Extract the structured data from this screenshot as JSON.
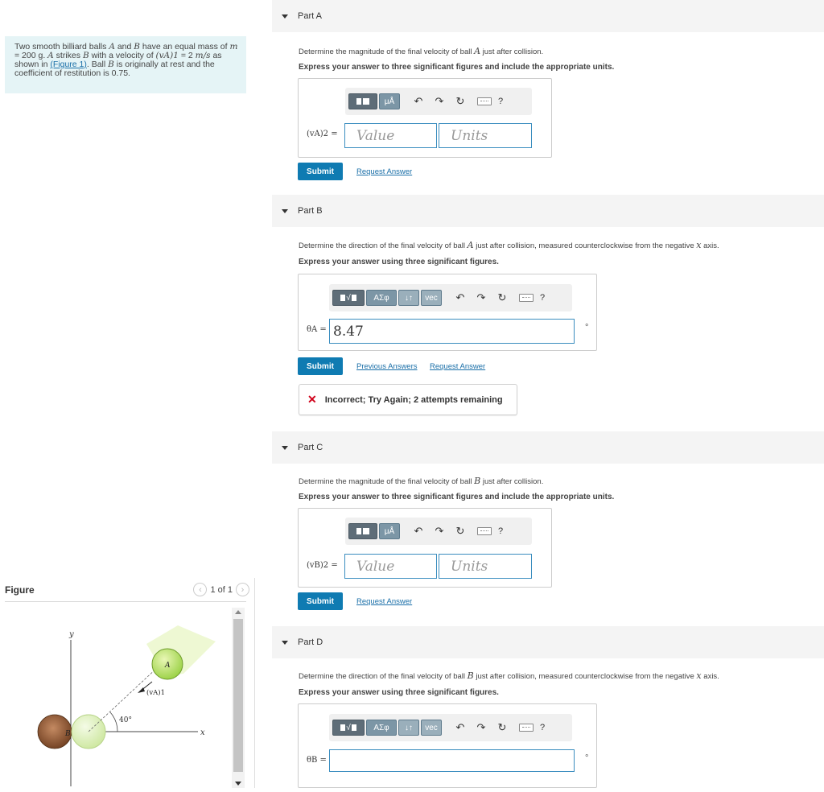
{
  "problem": {
    "text_1": "Two smooth billiard balls ",
    "var_A": "A",
    "text_2": " and ",
    "var_B": "B",
    "text_3": " have an equal mass of ",
    "mass_expr": "m",
    "text_4": " = 200 g. ",
    "var_A2": "A",
    "text_5": " strikes ",
    "var_B2": "B",
    "text_6": " with a velocity of ",
    "velocity_expr": "(vA)1",
    "text_7": " = 2 ",
    "units_expr": "m/s",
    "text_8": " as shown in ",
    "figure_link": "(Figure 1)",
    "text_9": ". Ball ",
    "var_B3": "B",
    "text_10": " is originally at rest and the coefficient of restitution is 0.75."
  },
  "figure": {
    "title": "Figure",
    "page_indicator": "1 of 1",
    "labels": {
      "y_axis": "y",
      "x_axis": "x",
      "ball_a": "A",
      "ball_b": "B",
      "velocity": "(vA)1",
      "angle": "40°"
    }
  },
  "parts": [
    {
      "title": "Part A",
      "instruction_1": "Determine the magnitude of the final velocity of ball ",
      "instruction_var": "A",
      "instruction_2": " just after collision.",
      "emphasis": "Express your answer to three significant figures and include the appropriate units.",
      "variable": "(vA)2 =",
      "value_placeholder": "Value",
      "units_placeholder": "Units",
      "submit": "Submit",
      "request": "Request Answer"
    },
    {
      "title": "Part B",
      "instruction_1": "Determine the direction of the final velocity of ball ",
      "instruction_var": "A",
      "instruction_2": " just after collision, measured counterclockwise from the negative ",
      "instruction_var2": "x",
      "instruction_3": " axis.",
      "emphasis": "Express your answer using three significant figures.",
      "variable": "θA =",
      "value": "8.47",
      "unit": "°",
      "submit": "Submit",
      "previous": "Previous Answers",
      "request": "Request Answer",
      "feedback": "Incorrect; Try Again; 2 attempts remaining"
    },
    {
      "title": "Part C",
      "instruction_1": "Determine the magnitude of the final velocity of ball ",
      "instruction_var": "B",
      "instruction_2": " just after collision.",
      "emphasis": "Express your answer to three significant figures and include the appropriate units.",
      "variable": "(vB)2 =",
      "value_placeholder": "Value",
      "units_placeholder": "Units",
      "submit": "Submit",
      "request": "Request Answer"
    },
    {
      "title": "Part D",
      "instruction_1": "Determine the direction of the final velocity of ball ",
      "instruction_var": "B",
      "instruction_2": " just after collision, measured counterclockwise from the negative ",
      "instruction_var2": "x",
      "instruction_3": " axis.",
      "emphasis": "Express your answer using three significant figures.",
      "variable": "θB =",
      "value": "",
      "unit": "°"
    }
  ],
  "toolbar": {
    "mu_label": "μÅ",
    "greek_label": "ΑΣφ",
    "updown_label": "↓↑",
    "vec_label": "vec",
    "help_label": "?"
  },
  "colors": {
    "submit": "#0f7bb2",
    "link": "#1a6fa8",
    "problem_bg": "#e5f4f6",
    "error": "#d0021b"
  }
}
